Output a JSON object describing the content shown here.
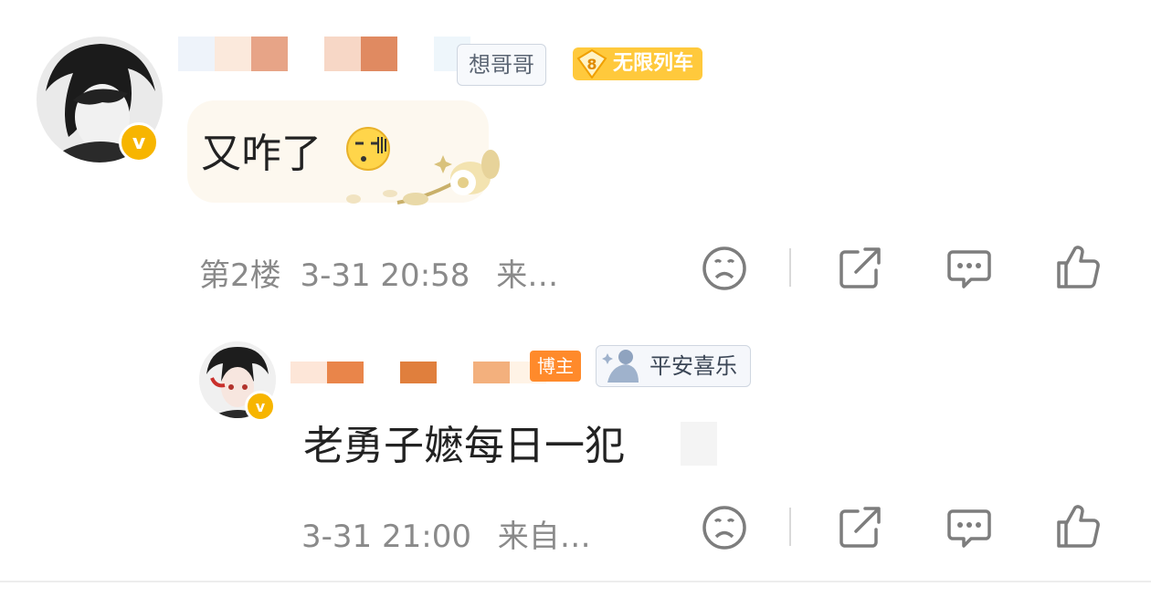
{
  "comments": [
    {
      "username_fragment": "想哥哥",
      "level_badge": "8",
      "badge_label": "无限列车",
      "text": "又咋了",
      "floor": "第2楼",
      "timestamp": "3-31 20:58",
      "source": "来…"
    },
    {
      "host_badge": "博主",
      "badge_label": "平安喜乐",
      "text": "老勇子嬷每日一犯",
      "timestamp": "3-31 21:00",
      "source": "来自…"
    }
  ],
  "icons": {
    "verified": "v",
    "reaction": "sad-face-icon",
    "share": "share-icon",
    "reply": "comment-icon",
    "like": "thumbs-up-icon"
  },
  "colors": {
    "accent_yellow": "#ffc93c",
    "verified": "#f7b500",
    "host_orange": "#ff8a2b",
    "meta_gray": "#8a8a8a"
  }
}
